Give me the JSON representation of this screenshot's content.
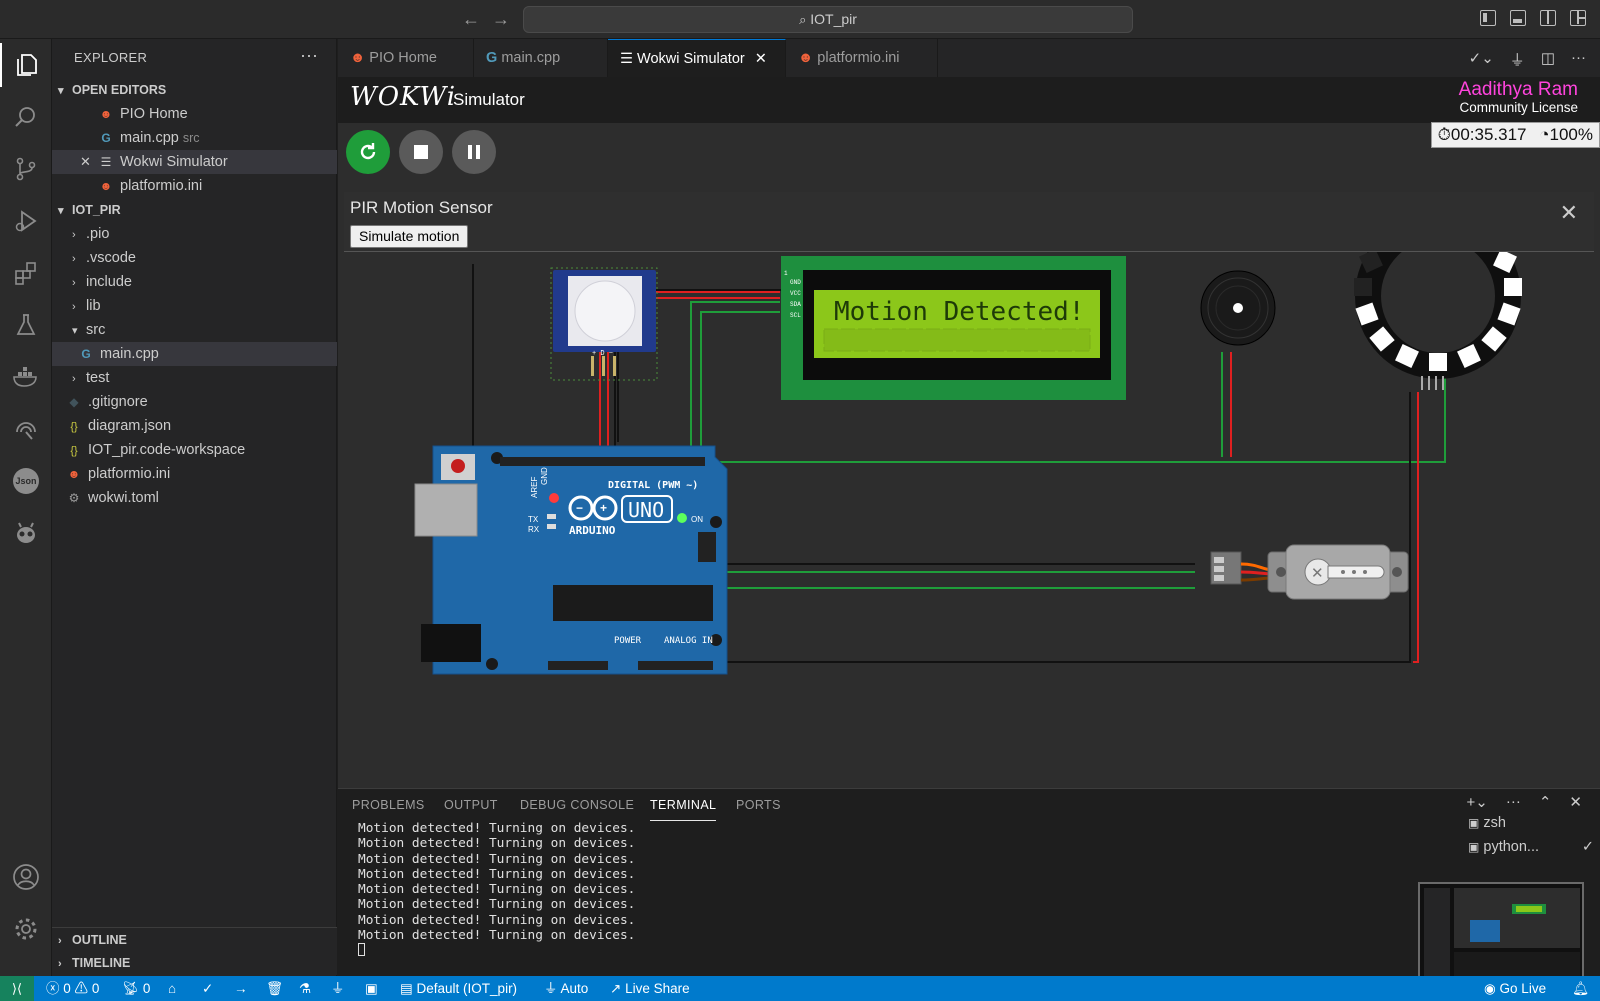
{
  "titlebar": {
    "search_text": "IOT_pir"
  },
  "explorer": {
    "title": "EXPLORER",
    "open_editors_label": "OPEN EDITORS",
    "open_editors": [
      {
        "name": "PIO Home",
        "detail": "",
        "icon": "platformio-icon"
      },
      {
        "name": "main.cpp",
        "detail": "src",
        "icon": "cpp-file-icon"
      },
      {
        "name": "Wokwi Simulator",
        "detail": "",
        "icon": "preview-icon"
      },
      {
        "name": "platformio.ini",
        "detail": "",
        "icon": "platformio-icon"
      }
    ],
    "project_label": "IOT_PIR",
    "tree": [
      {
        "name": ".pio",
        "type": "folder"
      },
      {
        "name": ".vscode",
        "type": "folder"
      },
      {
        "name": "include",
        "type": "folder"
      },
      {
        "name": "lib",
        "type": "folder"
      },
      {
        "name": "src",
        "type": "folder-open"
      },
      {
        "name": "main.cpp",
        "type": "cpp-file"
      },
      {
        "name": "test",
        "type": "folder"
      },
      {
        "name": ".gitignore",
        "type": "git-file"
      },
      {
        "name": "diagram.json",
        "type": "json-file"
      },
      {
        "name": "IOT_pir.code-workspace",
        "type": "json-file"
      },
      {
        "name": "platformio.ini",
        "type": "platformio-file"
      },
      {
        "name": "wokwi.toml",
        "type": "gear-file"
      }
    ],
    "outline_label": "OUTLINE",
    "timeline_label": "TIMELINE"
  },
  "tabs": [
    {
      "label": "PIO Home",
      "icon": "platformio-icon"
    },
    {
      "label": "main.cpp",
      "icon": "cpp-file-icon"
    },
    {
      "label": "Wokwi Simulator",
      "icon": "preview-icon"
    },
    {
      "label": "platformio.ini",
      "icon": "platformio-icon"
    }
  ],
  "wokwi": {
    "logo": "WOKWi",
    "title": "Simulator",
    "user_name": "Aadithya Ram",
    "license": "Community License",
    "timer": "00:35.317",
    "speed": "100%",
    "pir_panel_title": "PIR Motion Sensor",
    "simulate_button": "Simulate motion",
    "lcd_text": "Motion Detected!",
    "board_labels": {
      "digital": "DIGITAL (PWM ~)",
      "arduino": "ARDUINO",
      "uno": "UNO",
      "power": "POWER",
      "analog": "ANALOG IN",
      "tx": "TX",
      "rx": "RX",
      "on": "ON",
      "aref": "AREF",
      "gnd": "GND"
    },
    "lcd_pins": [
      "GND",
      "VCC",
      "SDA",
      "SCL"
    ],
    "lcd_pin_number": "1",
    "pir_pins": "+ D −"
  },
  "panel": {
    "tabs": [
      "PROBLEMS",
      "OUTPUT",
      "DEBUG CONSOLE",
      "TERMINAL",
      "PORTS"
    ],
    "active_tab": "TERMINAL",
    "terminal_lines": [
      "Motion detected! Turning on devices.",
      "Motion detected! Turning on devices.",
      "Motion detected! Turning on devices.",
      "Motion detected! Turning on devices.",
      "Motion detected! Turning on devices.",
      "Motion detected! Turning on devices.",
      "Motion detected! Turning on devices.",
      "Motion detected! Turning on devices."
    ],
    "terminals": [
      "zsh",
      "python..."
    ]
  },
  "statusbar": {
    "errors": "0",
    "warnings": "0",
    "ports": "0",
    "env": "Default (IOT_pir)",
    "auto": "Auto",
    "live_share": "Live Share",
    "go_live": "Go Live"
  },
  "colors": {
    "accent": "#007acc",
    "wire_red": "#e02020",
    "wire_green": "#1f9d3a",
    "lcd_bg": "#8cc71a",
    "wokwi_user": "#ff44dd",
    "restart_button": "#1f9d3a"
  }
}
